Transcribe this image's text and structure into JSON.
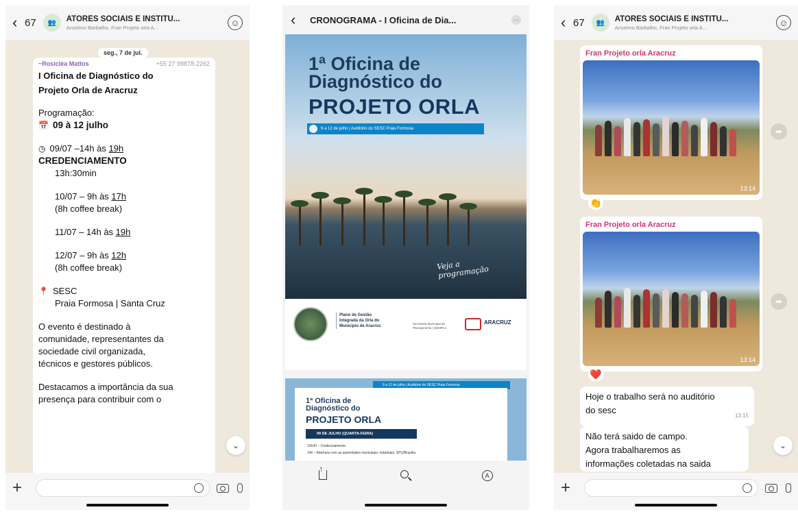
{
  "left_chat": {
    "back_count": "67",
    "group_avatar": "👥",
    "title": "ATORES SOCIAIS E INSTITU...",
    "subtitle": "Anselmo Barbalho, Fran Projeto orla A...",
    "date": "seg., 7 de jul.",
    "sender_name": "~Rosicléa Mattos",
    "sender_phone": "+55 27 99878-2262",
    "msg_title_1": "I Oficina de Diagnóstico do",
    "msg_title_2": "Projeto Orla de Aracruz",
    "programacao": "Programação:",
    "dates": "09 à 12 julho",
    "d1_a": "09/07 –14h às ",
    "d1_b": "19h",
    "credenciamento": "CREDENCIAMENTO",
    "cred_time": "13h:30min",
    "d2_a": "10/07 – 9h às ",
    "d2_b": "17h",
    "d2_note": "(8h coffee break)",
    "d3_a": "11/07 – 14h às ",
    "d3_b": "19h",
    "d4_a": "12/07 – 9h às ",
    "d4_b": "12h",
    "d4_note": "(8h coffee break)",
    "place": "SESC",
    "place_detail": "Praia Formosa | Santa Cruz",
    "p1": "O evento é destinado à",
    "p2": "comunidade, representantes da",
    "p3": "sociedade civil organizada,",
    "p4": "técnicos e gestores públicos.",
    "p5": "Destacamos a importância da sua",
    "p6": "presença para contribuir com o"
  },
  "browser": {
    "title": "CRONOGRAMA - I Oficina de Dia...",
    "poster_line1a": "1ª Oficina de",
    "poster_line1b": "Diagnóstico do",
    "poster_line2": "PROJETO ORLA",
    "poster_date": "9 a 12 de julho | Auditório do SESC Praia Formosa",
    "poster_script_1": "Veja a",
    "poster_script_2": "programação",
    "logo_text_1": "Plano de Gestão",
    "logo_text_2": "Integrada da Orla do",
    "logo_text_3": "Município de Aracruz",
    "gov_text": "Secretaria Municipal de Planejamento | SEMPLA",
    "aracruz": "ARACRUZ",
    "p2_date": "9 a 12 de julho | Auditório do SESC Praia Formosa",
    "p2_line1a": "1ª Oficina de",
    "p2_line1b": "Diagnóstico do",
    "p2_line2": "PROJETO ORLA",
    "p2_bar": "09 DE JULHO (QUARTA-FEIRA)",
    "p2_note1": "13h30 – Credenciamento",
    "p2_note2": "14h – Abertura com as autoridades municipais, estaduais, SPU/Brasília"
  },
  "right_chat": {
    "back_count": "67",
    "group_avatar": "👥",
    "title": "ATORES SOCIAIS E INSTITU...",
    "subtitle": "Anselmo Barbalho, Fran Projeto orla A...",
    "img1_sender": "Fran Projeto orla Aracruz",
    "img1_time": "13:14",
    "img1_reaction": "👏",
    "img2_sender": "Fran Projeto orla Aracruz",
    "img2_time": "13:14",
    "img2_reaction": "❤️",
    "txt1_line1": "Hoje o trabalho será no auditório",
    "txt1_line2": "do sesc",
    "txt1_time": "13:15",
    "txt2_line1": "Não terá saido de campo.",
    "txt2_line2": "Agora trabalharemos as",
    "txt2_line3": "informações coletadas na saida"
  },
  "icons": {
    "back": "‹",
    "plus": "+",
    "chevron_down": "⌄",
    "calendar": "📅",
    "clock": "◷",
    "pin": "📍",
    "forward": "➦",
    "markup": "A",
    "more": "···",
    "add_person": "☺"
  },
  "colors": {
    "chat_bg": "#efe8dd",
    "sender_purple": "#8e5fb6",
    "sender_pink": "#d6336c",
    "poster_blue": "#14375e",
    "accent_blue": "#0e84c8"
  }
}
